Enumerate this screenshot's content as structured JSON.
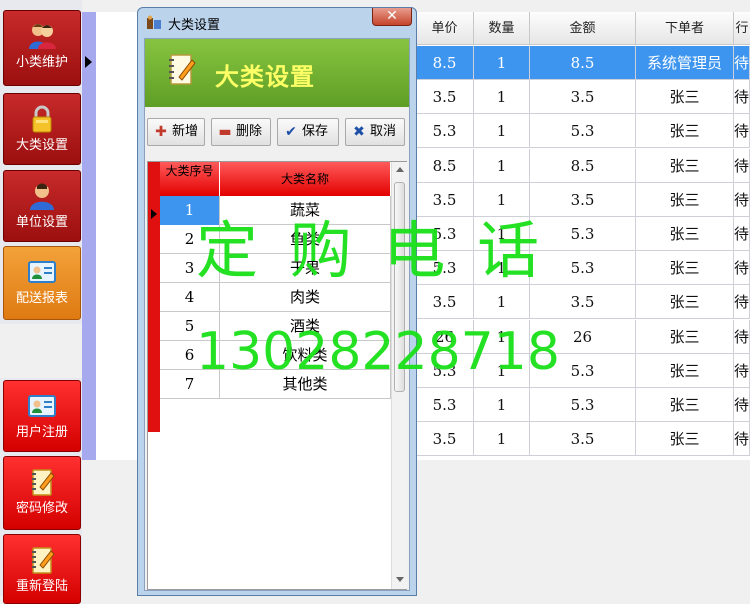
{
  "sidebar": {
    "items": [
      {
        "label": "小类维护",
        "icon": "users-icon"
      },
      {
        "label": "大类设置",
        "icon": "lock-icon"
      },
      {
        "label": "单位设置",
        "icon": "user-icon"
      },
      {
        "label": "配送报表",
        "icon": "id-card-icon"
      },
      {
        "label": "用户注册",
        "icon": "id-card-icon"
      },
      {
        "label": "密码修改",
        "icon": "notebook-icon"
      },
      {
        "label": "重新登陆",
        "icon": "notebook-icon"
      }
    ]
  },
  "grid": {
    "headers": [
      "单价",
      "数量",
      "金额",
      "下单者",
      "行"
    ],
    "rows": [
      [
        "8.5",
        "1",
        "8.5",
        "系统管理员",
        "待"
      ],
      [
        "3.5",
        "1",
        "3.5",
        "张三",
        "待"
      ],
      [
        "5.3",
        "1",
        "5.3",
        "张三",
        "待"
      ],
      [
        "8.5",
        "1",
        "8.5",
        "张三",
        "待"
      ],
      [
        "3.5",
        "1",
        "3.5",
        "张三",
        "待"
      ],
      [
        "5.3",
        "1",
        "5.3",
        "张三",
        "待"
      ],
      [
        "5.3",
        "1",
        "5.3",
        "张三",
        "待"
      ],
      [
        "3.5",
        "1",
        "3.5",
        "张三",
        "待"
      ],
      [
        "26",
        "1",
        "26",
        "张三",
        "待"
      ],
      [
        "5.3",
        "1",
        "5.3",
        "张三",
        "待"
      ],
      [
        "5.3",
        "1",
        "5.3",
        "张三",
        "待"
      ],
      [
        "3.5",
        "1",
        "3.5",
        "张三",
        "待"
      ]
    ]
  },
  "dialog": {
    "title": "大类设置",
    "close": "✕",
    "banner_title": "大类设置",
    "toolbar": {
      "add": "新增",
      "delete": "删除",
      "save": "保存",
      "cancel": "取消"
    },
    "table": {
      "headers": {
        "seq": "大类序号",
        "name": "大类名称"
      },
      "rows": [
        {
          "seq": "1",
          "name": "蔬菜"
        },
        {
          "seq": "2",
          "name": "鱼类"
        },
        {
          "seq": "3",
          "name": "干果"
        },
        {
          "seq": "4",
          "name": "肉类"
        },
        {
          "seq": "5",
          "name": "酒类"
        },
        {
          "seq": "6",
          "name": "饮料类"
        },
        {
          "seq": "7",
          "name": "其他类"
        }
      ]
    }
  },
  "watermark": {
    "line1": "定 购 电 话",
    "line2": "13028228718"
  },
  "colors": {
    "sidebar_red": "#b01b1b",
    "sidebar_orange": "#ea8c24",
    "selection_blue": "#3d95ef",
    "banner_green": "#72b236",
    "banner_text": "#ffff66",
    "watermark_green": "#19e019"
  }
}
